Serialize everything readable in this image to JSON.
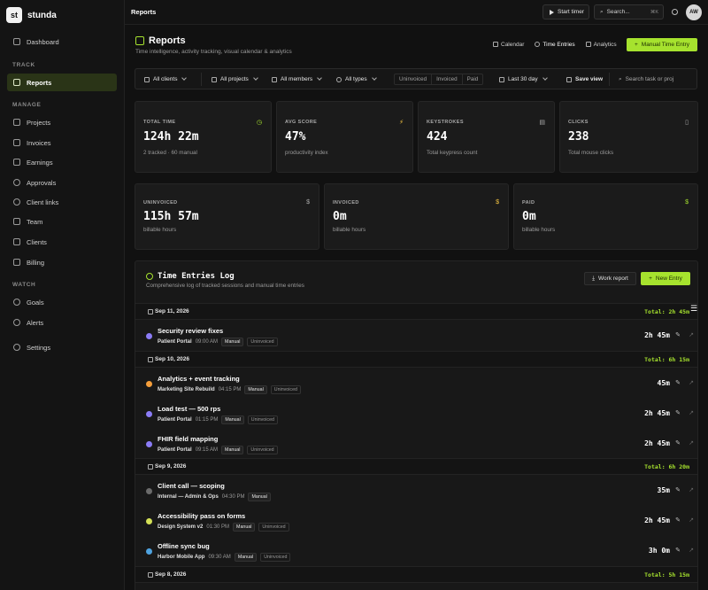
{
  "brand": {
    "logo": "st",
    "name": "stunda"
  },
  "sidebar": {
    "dashboard": "Dashboard",
    "section_track": "TRACK",
    "reports": "Reports",
    "section_manage": "MANAGE",
    "manage_items": [
      "Projects",
      "Invoices",
      "Earnings",
      "Approvals",
      "Client links",
      "Team",
      "Clients",
      "Billing"
    ],
    "section_watch": "WATCH",
    "watch_items": [
      "Goals",
      "Alerts"
    ],
    "settings": "Settings"
  },
  "topbar": {
    "title": "Reports",
    "start_timer": "Start timer",
    "search_placeholder": "Search...",
    "search_kbd": "⌘K",
    "avatar": "AW"
  },
  "page": {
    "title": "Reports",
    "subtitle": "Time intelligence, activity tracking, visual calendar & analytics",
    "tabs": [
      "Calendar",
      "Time Entries",
      "Analytics"
    ],
    "manual_entry": "Manual Time Entry"
  },
  "filters": {
    "clients": "All clients",
    "projects": "All projects",
    "members": "All members",
    "types": "All types",
    "status": [
      "Uninvoiced",
      "Invoiced",
      "Paid"
    ],
    "range": "Last 30 day",
    "save_view": "Save view",
    "search_placeholder": "Search task or proj"
  },
  "stats": [
    {
      "label": "TOTAL TIME",
      "value": "124h 22m",
      "note": "2 tracked · 60 manual"
    },
    {
      "label": "AVG SCORE",
      "value": "47%",
      "note": "productivity index"
    },
    {
      "label": "KEYSTROKES",
      "value": "424",
      "note": "Total keypress count"
    },
    {
      "label": "CLICKS",
      "value": "238",
      "note": "Total mouse clicks"
    }
  ],
  "billing_stats": [
    {
      "label": "UNINVOICED",
      "value": "115h 57m",
      "note": "billable hours",
      "icon": "$"
    },
    {
      "label": "INVOICED",
      "value": "0m",
      "note": "billable hours",
      "icon": "$"
    },
    {
      "label": "PAID",
      "value": "0m",
      "note": "billable hours",
      "icon": "$"
    }
  ],
  "log": {
    "title": "Time Entries Log",
    "subtitle": "Comprehensive log of tracked sessions and manual time entries",
    "work_report": "Work report",
    "new_entry": "New Entry",
    "days": [
      {
        "date": "Sep 11, 2026",
        "total": "Total: 2h 45m"
      },
      {
        "date": "Sep 10, 2026",
        "total": "Total: 6h 15m"
      },
      {
        "date": "Sep 9, 2026",
        "total": "Total: 6h 20m"
      },
      {
        "date": "Sep 8, 2026",
        "total": "Total: 5h 15m"
      }
    ],
    "entries": [
      {
        "title": "Security review fixes",
        "project": "Patient Portal",
        "time": "09:00 AM",
        "type": "Manual",
        "status": "Uninvoiced",
        "duration": "2h 45m",
        "color": "#8b7cf6"
      },
      {
        "title": "Analytics + event tracking",
        "project": "Marketing Site Rebuild",
        "time": "04:15 PM",
        "type": "Manual",
        "status": "Uninvoiced",
        "duration": "45m",
        "color": "#f59e3b"
      },
      {
        "title": "Load test — 500 rps",
        "project": "Patient Portal",
        "time": "01:15 PM",
        "type": "Manual",
        "status": "Uninvoiced",
        "duration": "2h 45m",
        "color": "#8b7cf6"
      },
      {
        "title": "FHIR field mapping",
        "project": "Patient Portal",
        "time": "09:15 AM",
        "type": "Manual",
        "status": "Uninvoiced",
        "duration": "2h 45m",
        "color": "#8b7cf6"
      },
      {
        "title": "Client call — scoping",
        "project": "Internal — Admin & Ops",
        "time": "04:30 PM",
        "type": "Manual",
        "status": "",
        "duration": "35m",
        "color": "#6b6b6b"
      },
      {
        "title": "Accessibility pass on forms",
        "project": "Design System v2",
        "time": "01:30 PM",
        "type": "Manual",
        "status": "Uninvoiced",
        "duration": "2h 45m",
        "color": "#d4e157"
      },
      {
        "title": "Offline sync bug",
        "project": "Harbor Mobile App",
        "time": "09:30 AM",
        "type": "Manual",
        "status": "Uninvoiced",
        "duration": "3h 0m",
        "color": "#4fa3e0"
      }
    ]
  },
  "colors": {
    "accent": "#a6e22e",
    "background": "#111111",
    "card": "#1b1b1b"
  }
}
